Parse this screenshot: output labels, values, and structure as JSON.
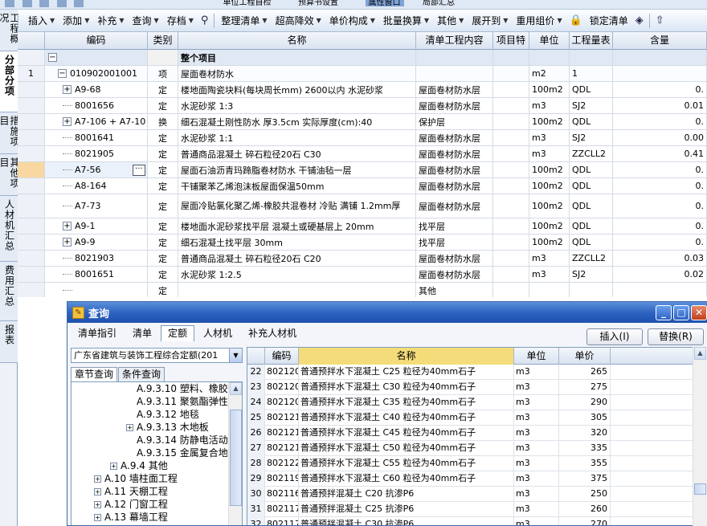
{
  "menubar_partial": {
    "items": [
      "单位工程自检",
      "预算书设置",
      "属性窗口",
      "局部汇总"
    ]
  },
  "toolbar": {
    "items": [
      {
        "label": "插入",
        "dropdown": true
      },
      {
        "label": "添加",
        "dropdown": true
      },
      {
        "label": "补充",
        "dropdown": true
      },
      {
        "label": "查询",
        "dropdown": true
      },
      {
        "label": "存档",
        "dropdown": true
      },
      {
        "label": "整理清单",
        "dropdown": true
      },
      {
        "label": "超高降效",
        "dropdown": true
      },
      {
        "label": "单价构成",
        "dropdown": true
      },
      {
        "label": "批量换算",
        "dropdown": true
      },
      {
        "label": "其他",
        "dropdown": true
      },
      {
        "label": "展开到",
        "dropdown": true
      },
      {
        "label": "重用组价",
        "dropdown": true
      },
      {
        "label": "锁定清单",
        "dropdown": false
      }
    ]
  },
  "side_tabs": [
    {
      "label": "工程概况",
      "active": false
    },
    {
      "label": "分部分项",
      "active": true
    },
    {
      "label": "措施项目",
      "active": false
    },
    {
      "label": "其他项目",
      "active": false
    },
    {
      "label": "人材机汇总",
      "active": false
    },
    {
      "label": "费用汇总",
      "active": false
    },
    {
      "label": "报表",
      "active": false
    }
  ],
  "grid": {
    "columns": [
      "编码",
      "类别",
      "名称",
      "清单工程内容",
      "项目特",
      "单位",
      "工程量表",
      "含量"
    ],
    "rows": [
      {
        "num": "",
        "code": "",
        "tree": "minus",
        "type": "",
        "name": "整个项目",
        "content": "",
        "unit": "",
        "qty": "",
        "amount": "",
        "kind": "header"
      },
      {
        "num": "1",
        "code": "010902001001",
        "tree": "minus",
        "type": "项",
        "name": "屋面卷材防水",
        "content": "",
        "unit": "m2",
        "qty": "1",
        "amount": "",
        "kind": "item"
      },
      {
        "num": "",
        "code": "A9-68",
        "tree": "plus",
        "type": "定",
        "name": "楼地面陶瓷块料(每块周长mm) 2600以内 水泥砂浆",
        "content": "屋面卷材防水层",
        "unit": "100m2",
        "qty": "QDL",
        "amount": "0.",
        "kind": "sub"
      },
      {
        "num": "",
        "code": "8001656",
        "tree": "line",
        "type": "定",
        "name": "水泥砂浆 1:3",
        "content": "屋面卷材防水层",
        "unit": "m3",
        "qty": "SJ2",
        "amount": "0.01",
        "kind": "sub"
      },
      {
        "num": "",
        "code": "A7-106 + A7-10",
        "tree": "plus",
        "type": "换",
        "name": "细石混凝土刚性防水 厚3.5cm 实际厚度(cm):40",
        "content": "保护层",
        "unit": "100m2",
        "qty": "QDL",
        "amount": "0.",
        "kind": "sub"
      },
      {
        "num": "",
        "code": "8001641",
        "tree": "line",
        "type": "定",
        "name": "水泥砂浆 1:1",
        "content": "屋面卷材防水层",
        "unit": "m3",
        "qty": "SJ2",
        "amount": "0.00",
        "kind": "sub"
      },
      {
        "num": "",
        "code": "8021905",
        "tree": "line",
        "type": "定",
        "name": "普通商品混凝土 碎石粒径20石 C30",
        "content": "屋面卷材防水层",
        "unit": "m3",
        "qty": "ZZCLL2",
        "amount": "0.41",
        "kind": "sub"
      },
      {
        "num": "",
        "code": "A7-56",
        "tree": "line",
        "type": "定",
        "name": "屋面石油沥青玛蹄脂卷材防水 干铺油毡一层",
        "content": "屋面卷材防水层",
        "unit": "100m2",
        "qty": "QDL",
        "amount": "0.",
        "kind": "selected"
      },
      {
        "num": "",
        "code": "A8-164",
        "tree": "line",
        "type": "定",
        "name": "干铺聚苯乙烯泡沫板屋面保温50mm",
        "content": "屋面卷材防水层",
        "unit": "100m2",
        "qty": "QDL",
        "amount": "0.",
        "kind": "sub"
      },
      {
        "num": "",
        "code": "A7-73",
        "tree": "line",
        "type": "定",
        "name": "屋面冷贴氯化聚乙烯-橡胶共混卷材 冷贴 满铺 1.2mm厚",
        "content": "屋面卷材防水层",
        "unit": "100m2",
        "qty": "QDL",
        "amount": "0.",
        "kind": "tall"
      },
      {
        "num": "",
        "code": "A9-1",
        "tree": "plus",
        "type": "定",
        "name": "楼地面水泥砂浆找平层 混凝土或硬基层上 20mm",
        "content": "找平层",
        "unit": "100m2",
        "qty": "QDL",
        "amount": "0.",
        "kind": "sub"
      },
      {
        "num": "",
        "code": "A9-9",
        "tree": "plus",
        "type": "定",
        "name": "细石混凝土找平层 30mm",
        "content": "找平层",
        "unit": "100m2",
        "qty": "QDL",
        "amount": "0.",
        "kind": "sub"
      },
      {
        "num": "",
        "code": "8021903",
        "tree": "line",
        "type": "定",
        "name": "普通商品混凝土 碎石粒径20石 C20",
        "content": "屋面卷材防水层",
        "unit": "m3",
        "qty": "ZZCLL2",
        "amount": "0.03",
        "kind": "sub"
      },
      {
        "num": "",
        "code": "8001651",
        "tree": "line",
        "type": "定",
        "name": "水泥砂浆 1:2.5",
        "content": "屋面卷材防水层",
        "unit": "m3",
        "qty": "SJ2",
        "amount": "0.02",
        "kind": "sub"
      },
      {
        "num": "",
        "code": "",
        "tree": "end",
        "type": "定",
        "name": "",
        "content": "其他",
        "unit": "",
        "qty": "",
        "amount": "",
        "kind": "sub"
      }
    ]
  },
  "dialog": {
    "title": "查询",
    "tabs": [
      {
        "label": "清单指引",
        "active": false
      },
      {
        "label": "清单",
        "active": false
      },
      {
        "label": "定额",
        "active": true
      },
      {
        "label": "人材机",
        "active": false
      },
      {
        "label": "补充人材机",
        "active": false
      }
    ],
    "insert_button": "插入(I)",
    "replace_button": "替换(R)",
    "quota_select": "广东省建筑与装饰工程综合定额(201",
    "left_tabs": [
      {
        "label": "章节查询",
        "active": true
      },
      {
        "label": "条件查询",
        "active": false
      }
    ],
    "tree": [
      {
        "label": "A.9.3.10 塑料、橡胶",
        "indent": 3,
        "toggle": "none"
      },
      {
        "label": "A.9.3.11 聚氨酯弹性",
        "indent": 3,
        "toggle": "none"
      },
      {
        "label": "A.9.3.12 地毯",
        "indent": 3,
        "toggle": "none"
      },
      {
        "label": "A.9.3.13 木地板",
        "indent": 3,
        "toggle": "plus"
      },
      {
        "label": "A.9.3.14 防静电活动",
        "indent": 3,
        "toggle": "none"
      },
      {
        "label": "A.9.3.15 金属复合地",
        "indent": 3,
        "toggle": "none"
      },
      {
        "label": "A.9.4 其他",
        "indent": 2,
        "toggle": "plus"
      },
      {
        "label": "A.10 墙柱面工程",
        "indent": 1,
        "toggle": "plus"
      },
      {
        "label": "A.11 天棚工程",
        "indent": 1,
        "toggle": "plus"
      },
      {
        "label": "A.12 门窗工程",
        "indent": 1,
        "toggle": "plus"
      },
      {
        "label": "A.13 幕墙工程",
        "indent": 1,
        "toggle": "plus"
      }
    ],
    "result_columns": [
      "编码",
      "名称",
      "单位",
      "单价"
    ],
    "results": [
      {
        "num": "22",
        "code": "802120",
        "name": "普通预拌水下混凝土 C25 粒径为40mm石子",
        "unit": "m3",
        "price": "265"
      },
      {
        "num": "23",
        "code": "802120",
        "name": "普通预拌水下混凝土 C30 粒径为40mm石子",
        "unit": "m3",
        "price": "275"
      },
      {
        "num": "24",
        "code": "802120",
        "name": "普通预拌水下混凝土 C35 粒径为40mm石子",
        "unit": "m3",
        "price": "290"
      },
      {
        "num": "25",
        "code": "802121",
        "name": "普通预拌水下混凝土 C40 粒径为40mm石子",
        "unit": "m3",
        "price": "305"
      },
      {
        "num": "26",
        "code": "802121",
        "name": "普通预拌水下混凝土 C45 粒径为40mm石子",
        "unit": "m3",
        "price": "320"
      },
      {
        "num": "27",
        "code": "802121",
        "name": "普通预拌水下混凝土 C50 粒径为40mm石子",
        "unit": "m3",
        "price": "335"
      },
      {
        "num": "28",
        "code": "802122",
        "name": "普通预拌水下混凝土 C55 粒径为40mm石子",
        "unit": "m3",
        "price": "355"
      },
      {
        "num": "29",
        "code": "802119",
        "name": "普通预拌水下混凝土 C60 粒径为40mm石子",
        "unit": "m3",
        "price": "375"
      },
      {
        "num": "30",
        "code": "802116",
        "name": "普通预拌混凝土 C20 抗渗P6",
        "unit": "m3",
        "price": "250"
      },
      {
        "num": "31",
        "code": "802117",
        "name": "普通预拌混凝土 C25 抗渗P6",
        "unit": "m3",
        "price": "260"
      },
      {
        "num": "32",
        "code": "802117",
        "name": "普通预拌混凝土 C30 抗渗P6",
        "unit": "m3",
        "price": "270"
      }
    ]
  },
  "colors": {
    "accent": "#2b61c0",
    "selected_row": "#f8d8a0",
    "header_row": "#dfe8f3"
  }
}
